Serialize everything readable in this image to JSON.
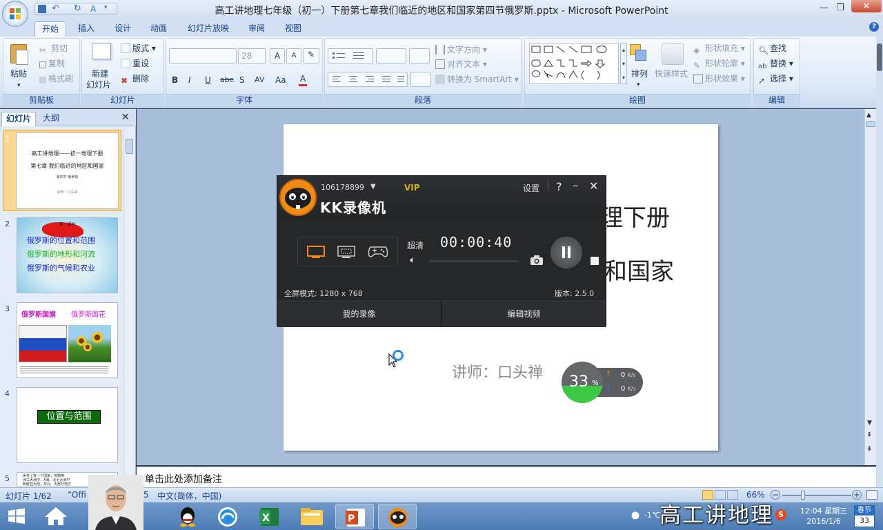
{
  "window": {
    "title": "高工讲地理七年级（初一）下册第七章我们临近的地区和国家第四节俄罗斯.pptx - Microsoft PowerPoint",
    "qat_extra": "A"
  },
  "tabs": [
    "开始",
    "插入",
    "设计",
    "动画",
    "幻灯片放映",
    "审阅",
    "视图"
  ],
  "ribbon": {
    "clipboard": {
      "label": "剪贴板",
      "paste": "粘贴",
      "cut": "剪切",
      "copy": "复制",
      "format_painter": "格式刷"
    },
    "slides": {
      "label": "幻灯片",
      "new_slide_1": "新建",
      "new_slide_2": "幻灯片",
      "layout": "版式",
      "reset": "重设",
      "delete": "删除"
    },
    "font": {
      "label": "字体",
      "size": "28",
      "grow": "A",
      "shrink": "A",
      "bold": "B",
      "italic": "I",
      "underline": "U",
      "strike": "abc",
      "shadow": "S",
      "spacing": "AV",
      "case": "Aa",
      "color": "A"
    },
    "paragraph": {
      "label": "段落",
      "text_direction": "文字方向",
      "align_text": "对齐文本",
      "smartart": "转换为 SmartArt"
    },
    "drawing": {
      "label": "绘图",
      "arrange": "排列",
      "quick_styles": "快速样式",
      "shape_fill": "形状填充",
      "shape_outline": "形状轮廓",
      "shape_effects": "形状效果"
    },
    "editing": {
      "label": "编辑",
      "find": "查找",
      "replace": "替换",
      "select": "选择"
    }
  },
  "panel": {
    "tab_slides": "幻灯片",
    "tab_outline": "大纲"
  },
  "thumbnails": [
    {
      "num": "1",
      "lines": [
        "高工讲地理——初一地理下册",
        "第七章 我们临近的地区和国家",
        "第四节 俄罗斯",
        "讲师：口头禅"
      ]
    },
    {
      "num": "2",
      "lines": [
        "第一课时",
        "俄罗斯的位置和范围",
        "俄罗斯的地形和河流",
        "俄罗斯的气候和农业"
      ]
    },
    {
      "num": "3",
      "lines": [
        "俄罗斯国旗",
        "俄罗斯国花"
      ]
    },
    {
      "num": "4",
      "lines": [
        "位置与范围"
      ]
    },
    {
      "num": "5",
      "lines": [
        "世界上有一个国家，地跨两",
        "洲三大洲中，A洲。北七大洲中",
        "和欧亚大陆，东北。大部分地方"
      ]
    }
  ],
  "slide": {
    "line1": "理下册",
    "line2": "和国家",
    "lecturer": "讲师：口头禅"
  },
  "notes_placeholder": "单击此处添加备注",
  "status": {
    "slide_count": "幻灯片 1/62",
    "theme": "“Offi",
    "theme_tail": "5",
    "language": "中文(简体，中国)",
    "zoom": "66%"
  },
  "recorder": {
    "account": "106178899",
    "vip": "VIP",
    "logo": "KK录像机",
    "settings": "设置",
    "help": "?",
    "quality": "超清",
    "time": "00:00:40",
    "mode_label": "全屏模式: 1280 x 768",
    "version": "版本: 2.5.0",
    "my_recordings": "我的录像",
    "edit_video": "编辑视频"
  },
  "netmeter": {
    "percent": "33",
    "unit": "%",
    "up": "0",
    "down": "0",
    "speed_unit": "K/s"
  },
  "taskbar": {
    "weather": "-1℃",
    "time": "12:04 星期三",
    "date": "2016/1/6",
    "calendar_top": "春节",
    "calendar_day": "33"
  },
  "watermark": "高工讲地理",
  "colors": {
    "ribbon_bg": "#dde9f7",
    "slide_area": "#a8bedb",
    "recorder_bg": "#252729",
    "recorder_accent": "#f08a16",
    "netmeter_green": "#3cc843"
  }
}
